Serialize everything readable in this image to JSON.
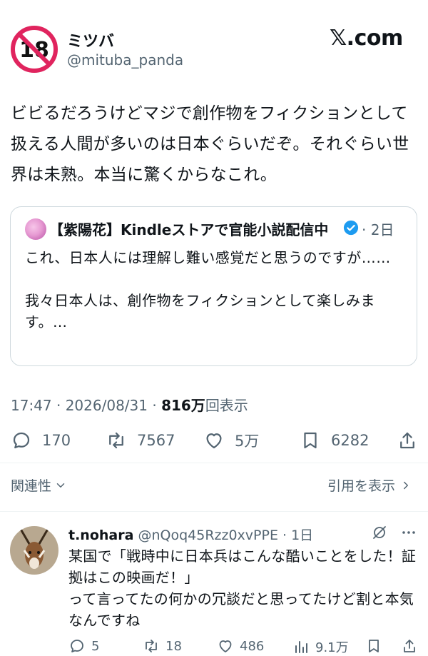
{
  "author": {
    "display_name": "ミツバ",
    "handle": "@mituba_panda",
    "avatar_badge_text": "18"
  },
  "brand": "𝕏.com",
  "post": {
    "text": "ビビるだろうけどマジで創作物をフィクションとして扱える人間が多いのは日本ぐらいだぞ。それぐらい世界は未熟。本当に驚くからなこれ。",
    "quote": {
      "name": "【紫陽花】Kindleストアで官能小説配信中",
      "time": "· 2日",
      "text": "これ、日本人には理解し難い感覚だと思うのですが……\n\n我々日本人は、創作物をフィクションとして楽しみます。…"
    },
    "meta": {
      "timestamp": "17:47 · 2026/08/31 · ",
      "views_count": "816万",
      "views_label": "回表示"
    },
    "actions": {
      "replies": "170",
      "reposts": "7567",
      "likes": "5万",
      "bookmarks": "6282"
    }
  },
  "sort": {
    "relevance_label": "関連性",
    "view_quotes_label": "引用を表示"
  },
  "reply": {
    "display_name": "t.nohara",
    "handle_time": " @nQoq45Rzz0xvPPE · 1日",
    "text": "某国で「戦時中に日本兵はこんな酷いことをした！証拠はこの映画だ！」\nって言ってたの何かの冗談だと思ってたけど割と本気なんですね",
    "actions": {
      "replies": "5",
      "reposts": "18",
      "likes": "486",
      "views": "9.1万"
    }
  },
  "colors": {
    "text": "#0f1419",
    "muted": "#536471",
    "border": "#cfd9de",
    "verified": "#1d9bf0",
    "no_sign": "#e0245e"
  }
}
